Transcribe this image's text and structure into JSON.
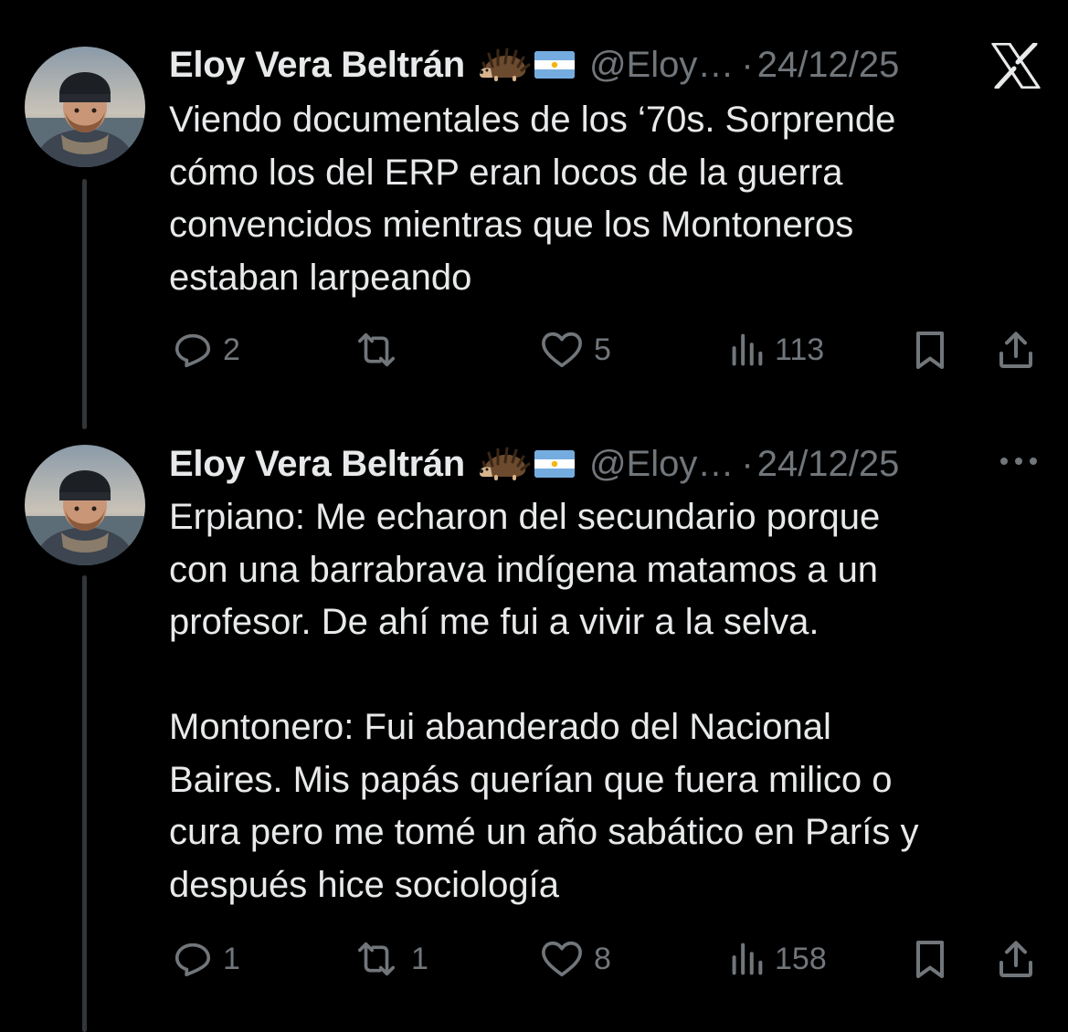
{
  "tweets": [
    {
      "display_name": "Eloy Vera Beltrán",
      "emojis": [
        "hedgehog-emoji",
        "argentina-flag-emoji"
      ],
      "handle": "@Eloy…",
      "separator": "·",
      "date": "24/12/25",
      "top_right_icon": "x-logo-icon",
      "text": "Viendo documentales de los ‘70s. Sorprende\ncómo los del ERP eran locos de la guerra\nconvencidos mientras que los Montoneros\nestaban larpeando",
      "replies": "2",
      "reposts": "",
      "likes": "5",
      "views": "113"
    },
    {
      "display_name": "Eloy Vera Beltrán",
      "emojis": [
        "hedgehog-emoji",
        "argentina-flag-emoji"
      ],
      "handle": "@Eloy…",
      "separator": "·",
      "date": "24/12/25",
      "top_right_icon": "more-icon",
      "text": "Erpiano: Me echaron del secundario porque\ncon una barrabrava indígena matamos a un\nprofesor. De ahí me fui a vivir a la selva.\n\nMontonero: Fui abanderado del Nacional\nBaires. Mis papás querían que fuera milico o\ncura pero me tomé un año sabático en París y\ndespués hice sociología",
      "replies": "1",
      "reposts": "1",
      "likes": "8",
      "views": "158"
    }
  ],
  "colors": {
    "background": "#000000",
    "primary_text": "#e7e9ea",
    "secondary_text": "#71767b",
    "thread_line": "#333639",
    "flag_blue": "#74acdf"
  }
}
